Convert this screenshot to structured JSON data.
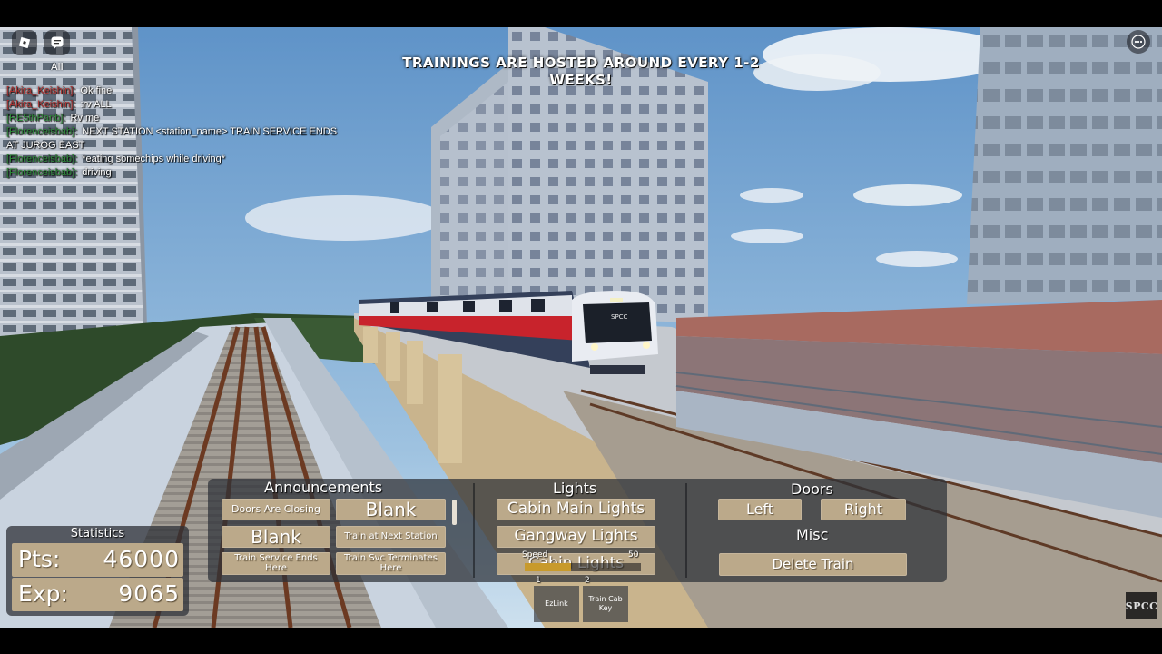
{
  "topbar": {
    "chat_tab_label": "All"
  },
  "icons": {
    "roblox_menu": "roblox-logo-icon",
    "chat": "chat-bubble-icon",
    "more": "ellipsis-icon"
  },
  "chat": {
    "messages": [
      {
        "name": "[Akira_Keishin]:",
        "text": "Ok fine",
        "color": "#b03030"
      },
      {
        "name": "[Akira_Keishin]:",
        "text": ":rv ALL",
        "color": "#b03030"
      },
      {
        "name": "[RE5thPanb]:",
        "text": "Rv me",
        "color": "#2f8a3a"
      },
      {
        "name": "[Florenceisbab]:",
        "text": "NEXT STATION <station_name> TRAIN SERVICE ENDS AT JUROG EAST",
        "color": "#2f8a3a"
      },
      {
        "name": "[Florenceisbab]:",
        "text": "*eating somechips while driving*",
        "color": "#2f8a3a"
      },
      {
        "name": "[Florenceisbab]:",
        "text": "driving",
        "color": "#2f8a3a"
      }
    ]
  },
  "banner": {
    "text": "TRAININGS ARE HOSTED AROUND EVERY 1-2 WEEKS!"
  },
  "announcements": {
    "title": "Announcements",
    "buttons": [
      "Doors Are Closing",
      "Blank",
      "Blank",
      "Train at Next Station",
      "Train Service Ends Here",
      "Train Svc Terminates Here"
    ]
  },
  "lights": {
    "title": "Lights",
    "buttons": [
      "Cabin Main Lights",
      "Gangway Lights",
      "Cabin Lights"
    ]
  },
  "doors": {
    "title": "Doors",
    "left_label": "Left",
    "right_label": "Right"
  },
  "misc": {
    "title": "Misc",
    "delete_label": "Delete Train"
  },
  "statistics": {
    "title": "Statistics",
    "pts_label": "Pts:",
    "pts_value": "46000",
    "exp_label": "Exp:",
    "exp_value": "9065"
  },
  "speed": {
    "label": "Speed",
    "max": "50",
    "current": 20
  },
  "hotbar": [
    {
      "number": "1",
      "label": "EzLink"
    },
    {
      "number": "2",
      "label": "Train Cab Key"
    }
  ],
  "brand": {
    "badge": "SPCC",
    "train_sign": "SPCC"
  },
  "colors": {
    "button_tan": "#bba98a",
    "panel_bg": "#2d3037",
    "train_stripe": "#c8232c"
  }
}
